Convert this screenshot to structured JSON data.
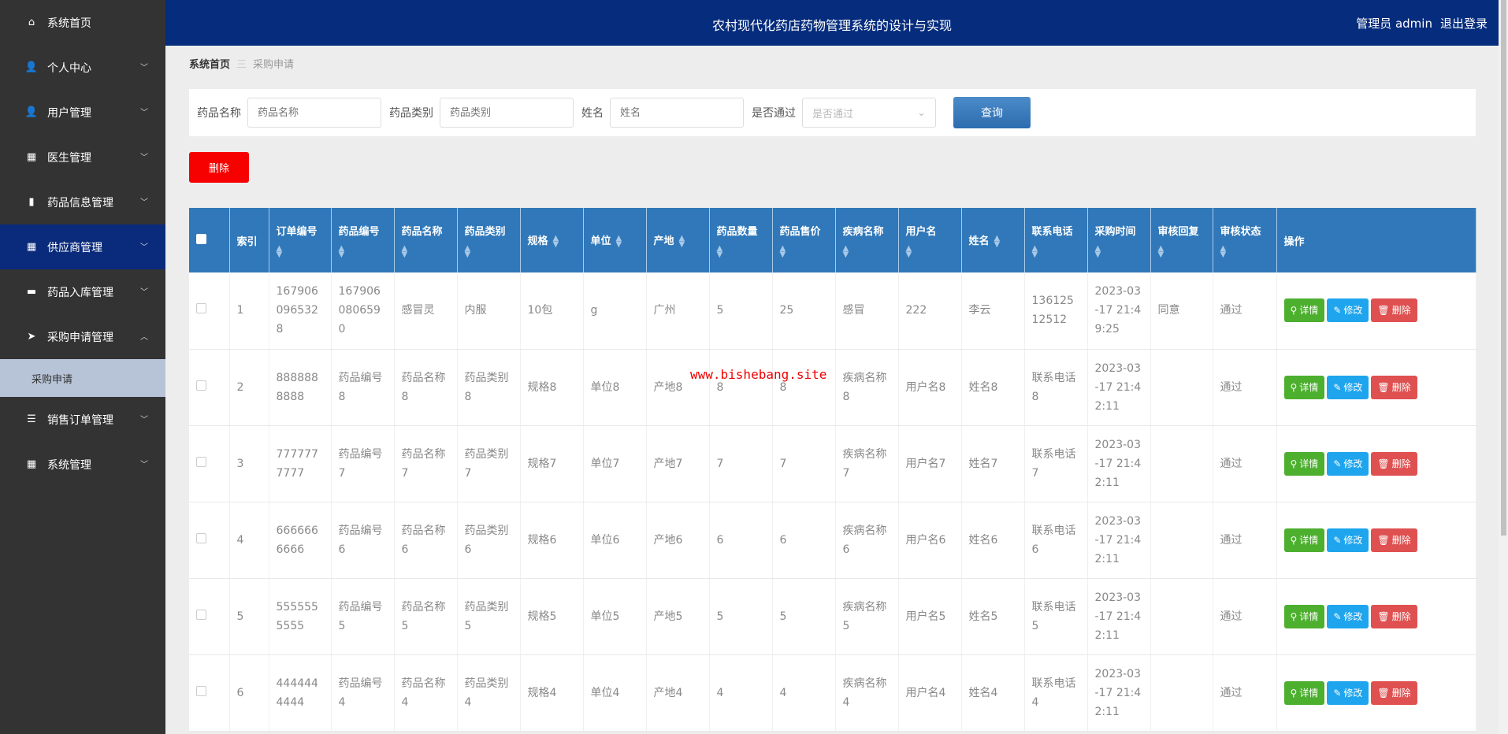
{
  "header": {
    "title": "农村现代化药店药物管理系统的设计与实现",
    "user": "管理员 admin",
    "logout": "退出登录"
  },
  "sidebar": {
    "items": [
      {
        "label": "系统首页",
        "icon": "home-icon",
        "glyph": "⌂",
        "chev": false
      },
      {
        "label": "个人中心",
        "icon": "user-icon",
        "glyph": "👤",
        "chev": true
      },
      {
        "label": "用户管理",
        "icon": "user-icon",
        "glyph": "👤",
        "chev": true
      },
      {
        "label": "医生管理",
        "icon": "grid-icon",
        "glyph": "▦",
        "chev": true
      },
      {
        "label": "药品信息管理",
        "icon": "bar-chart-icon",
        "glyph": "▮",
        "chev": true
      },
      {
        "label": "供应商管理",
        "icon": "grid-icon",
        "glyph": "▦",
        "chev": true,
        "active": true
      },
      {
        "label": "药品入库管理",
        "icon": "sign-icon",
        "glyph": "▬",
        "chev": true
      },
      {
        "label": "采购申请管理",
        "icon": "send-icon",
        "glyph": "➤",
        "chev": true,
        "open": true,
        "sub": [
          "采购申请"
        ]
      },
      {
        "label": "销售订单管理",
        "icon": "list-icon",
        "glyph": "☰",
        "chev": true
      },
      {
        "label": "系统管理",
        "icon": "grid-icon",
        "glyph": "▦",
        "chev": true
      }
    ]
  },
  "breadcrumb": {
    "home": "系统首页",
    "sep": "三",
    "current": "采购申请"
  },
  "search": {
    "fields": [
      {
        "label": "药品名称",
        "placeholder": "药品名称"
      },
      {
        "label": "药品类别",
        "placeholder": "药品类别"
      },
      {
        "label": "姓名",
        "placeholder": "姓名"
      }
    ],
    "select": {
      "label": "是否通过",
      "placeholder": "是否通过"
    },
    "query": "查询"
  },
  "delete_label": "删除",
  "table": {
    "columns": [
      "索引",
      "订单编号",
      "药品编号",
      "药品名称",
      "药品类别",
      "规格",
      "单位",
      "产地",
      "药品数量",
      "药品售价",
      "疾病名称",
      "用户名",
      "姓名",
      "联系电话",
      "采购时间",
      "审核回复",
      "审核状态",
      "操作"
    ],
    "actions": {
      "detail": "详情",
      "edit": "修改",
      "delete": "删除"
    },
    "rows": [
      [
        "1",
        "1679060965328",
        "1679060806590",
        "感冒灵",
        "内服",
        "10包",
        "g",
        "广州",
        "5",
        "25",
        "感冒",
        "222",
        "李云",
        "13612512512",
        "2023-03-17 21:49:25",
        "同意",
        "通过"
      ],
      [
        "2",
        "8888888888",
        "药品编号8",
        "药品名称8",
        "药品类别8",
        "规格8",
        "单位8",
        "产地8",
        "8",
        "8",
        "疾病名称8",
        "用户名8",
        "姓名8",
        "联系电话8",
        "2023-03-17 21:42:11",
        "",
        "通过"
      ],
      [
        "3",
        "7777777777",
        "药品编号7",
        "药品名称7",
        "药品类别7",
        "规格7",
        "单位7",
        "产地7",
        "7",
        "7",
        "疾病名称7",
        "用户名7",
        "姓名7",
        "联系电话7",
        "2023-03-17 21:42:11",
        "",
        "通过"
      ],
      [
        "4",
        "6666666666",
        "药品编号6",
        "药品名称6",
        "药品类别6",
        "规格6",
        "单位6",
        "产地6",
        "6",
        "6",
        "疾病名称6",
        "用户名6",
        "姓名6",
        "联系电话6",
        "2023-03-17 21:42:11",
        "",
        "通过"
      ],
      [
        "5",
        "5555555555",
        "药品编号5",
        "药品名称5",
        "药品类别5",
        "规格5",
        "单位5",
        "产地5",
        "5",
        "5",
        "疾病名称5",
        "用户名5",
        "姓名5",
        "联系电话5",
        "2023-03-17 21:42:11",
        "",
        "通过"
      ],
      [
        "6",
        "4444444444",
        "药品编号4",
        "药品名称4",
        "药品类别4",
        "规格4",
        "单位4",
        "产地4",
        "4",
        "4",
        "疾病名称4",
        "用户名4",
        "姓名4",
        "联系电话4",
        "2023-03-17 21:42:11",
        "",
        "通过"
      ]
    ]
  },
  "watermark": "www.bishebang.site",
  "colors": {
    "sidebar": "#333333",
    "header": "#062d7d",
    "table_header": "#3078b9",
    "danger": "#f70000",
    "detail": "#4caf2e",
    "edit": "#1ea5ee",
    "remove": "#df5050"
  }
}
